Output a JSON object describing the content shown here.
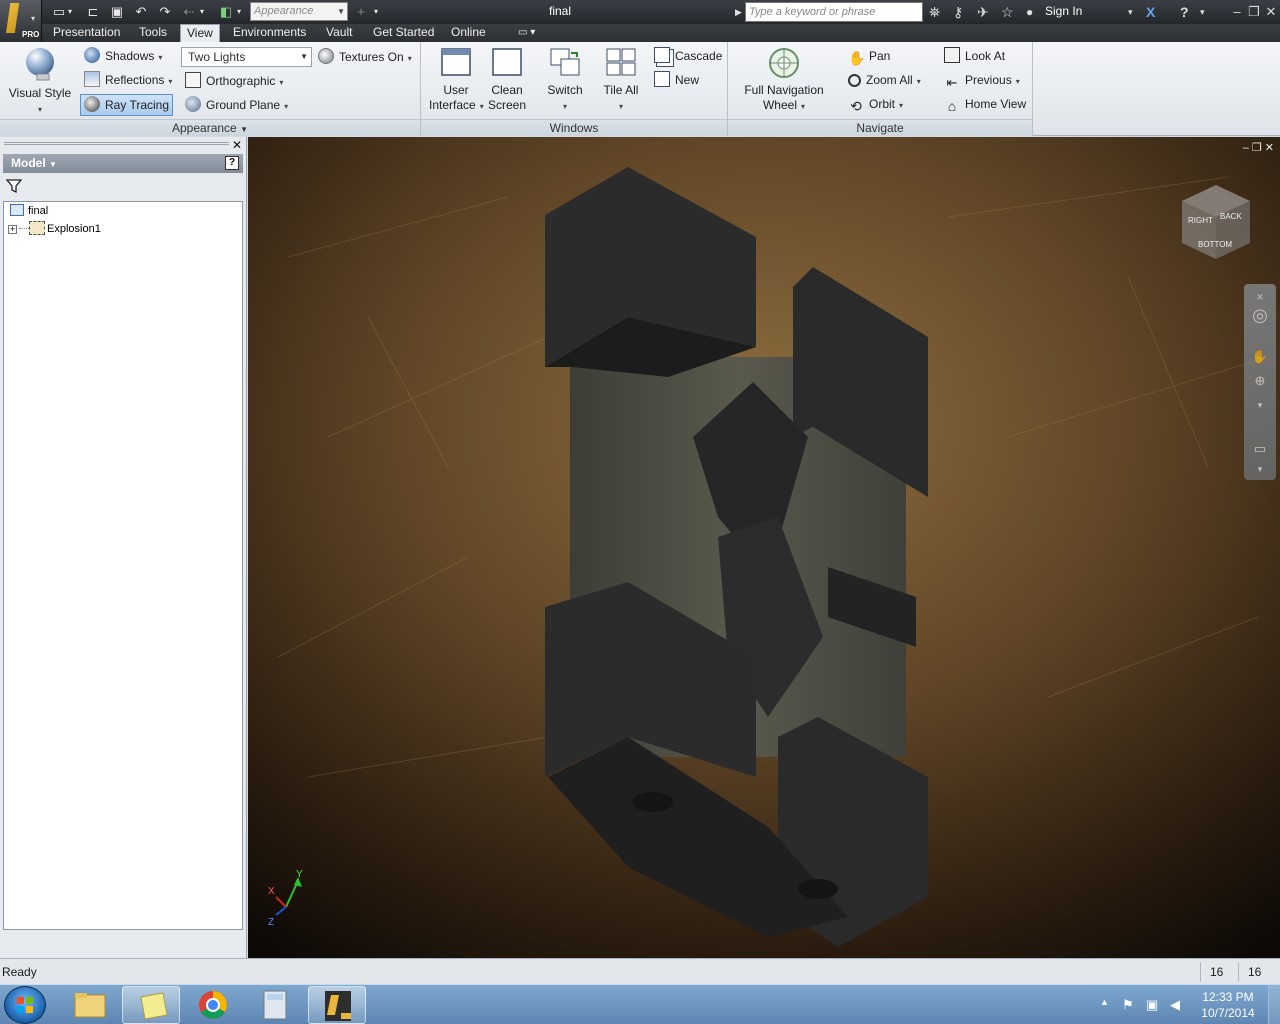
{
  "titlebar": {
    "appearance_placeholder": "Appearance",
    "document_title": "final",
    "search_placeholder": "Type a keyword or phrase",
    "sign_in": "Sign In",
    "app_badge": "PRO"
  },
  "tabs": [
    "Presentation",
    "Tools",
    "View",
    "Environments",
    "Vault",
    "Get Started",
    "Online"
  ],
  "active_tab": "View",
  "ribbon": {
    "appearance": {
      "visual_style": "Visual Style",
      "shadows": "Shadows",
      "reflections": "Reflections",
      "ray_tracing": "Ray Tracing",
      "lights": "Two Lights",
      "orthographic": "Orthographic",
      "ground_plane": "Ground Plane",
      "textures": "Textures On",
      "label": "Appearance"
    },
    "windows": {
      "user_interface_1": "User",
      "user_interface_2": "Interface",
      "clean_screen_1": "Clean",
      "clean_screen_2": "Screen",
      "switch": "Switch",
      "tile_all": "Tile All",
      "cascade": "Cascade",
      "new": "New",
      "label": "Windows"
    },
    "navigate": {
      "full_nav_1": "Full Navigation",
      "full_nav_2": "Wheel",
      "pan": "Pan",
      "zoom_all": "Zoom All",
      "orbit": "Orbit",
      "look_at": "Look At",
      "previous": "Previous",
      "home_view": "Home View",
      "label": "Navigate"
    }
  },
  "browser": {
    "header": "Model",
    "help": "?",
    "tree": [
      "final",
      "Explosion1"
    ]
  },
  "viewcube": {
    "faces": [
      "RIGHT",
      "BACK",
      "BOTTOM"
    ]
  },
  "triad": {
    "x": "X",
    "y": "Y",
    "z": "Z"
  },
  "status": {
    "text": "Ready",
    "count_a": "16",
    "count_b": "16"
  },
  "taskbar": {
    "time": "12:33 PM",
    "date": "10/7/2014"
  },
  "colors": {
    "accent": "#5b8fc7",
    "model_dark": "#2b2b2b",
    "titlebar": "#2c2f33"
  }
}
